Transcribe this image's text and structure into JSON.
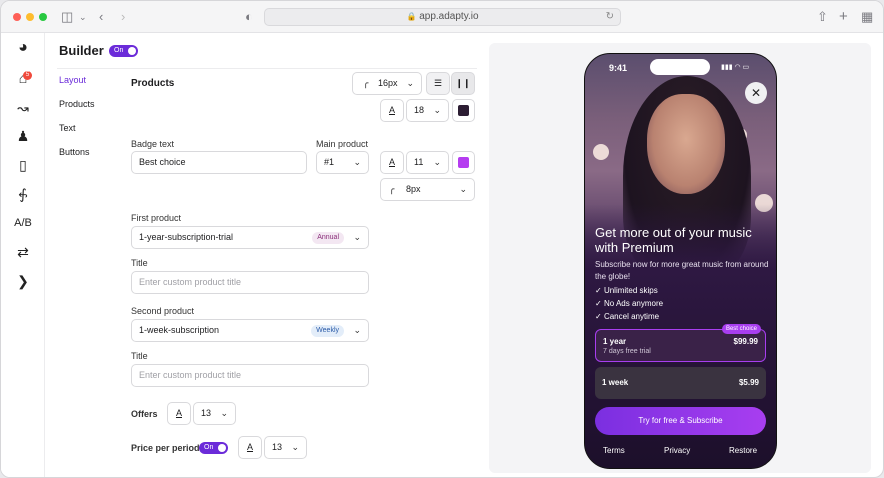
{
  "browser": {
    "url": "app.adapty.io"
  },
  "header": {
    "title": "Builder",
    "toggle": "On"
  },
  "nav": [
    "Layout",
    "Products",
    "Text",
    "Buttons"
  ],
  "sidebar": {
    "notification_count": "5"
  },
  "products": {
    "section_title": "Products",
    "corner_radius": "16px",
    "font_size": "18",
    "badge_label": "Badge text",
    "badge_value": "Best choice",
    "main_label": "Main product",
    "main_value": "#1",
    "badge_font_size": "11",
    "badge_radius": "8px",
    "first_label": "First product",
    "first_value": "1-year-subscription-trial",
    "first_pill": "Annual",
    "title1_label": "Title",
    "title1_placeholder": "Enter custom product title",
    "second_label": "Second product",
    "second_value": "1-week-subscription",
    "second_pill": "Weekly",
    "title2_label": "Title",
    "title2_placeholder": "Enter custom product title",
    "offers_label": "Offers",
    "offers_size": "13",
    "ppp_label": "Price per period",
    "ppp_toggle": "On",
    "ppp_size": "13",
    "text_icon": "A"
  },
  "phone": {
    "time": "9:41",
    "headline": "Get more out of your music with Premium",
    "sub": "Subscribe now for more great music from around the globe!",
    "features": [
      "Unlimited skips",
      "No Ads anymore",
      "Cancel anytime"
    ],
    "plan1": {
      "name": "1 year",
      "price": "$99.99",
      "trial": "7 days free trial",
      "badge": "Best choice"
    },
    "plan2": {
      "name": "1 week",
      "price": "$5.99"
    },
    "cta": "Try for free & Subscribe",
    "footer": [
      "Terms",
      "Privacy",
      "Restore"
    ]
  },
  "colors": {
    "accent": "#6b2bd9",
    "badge_color": "#b53cf0",
    "text_color": "#2c1d33"
  }
}
